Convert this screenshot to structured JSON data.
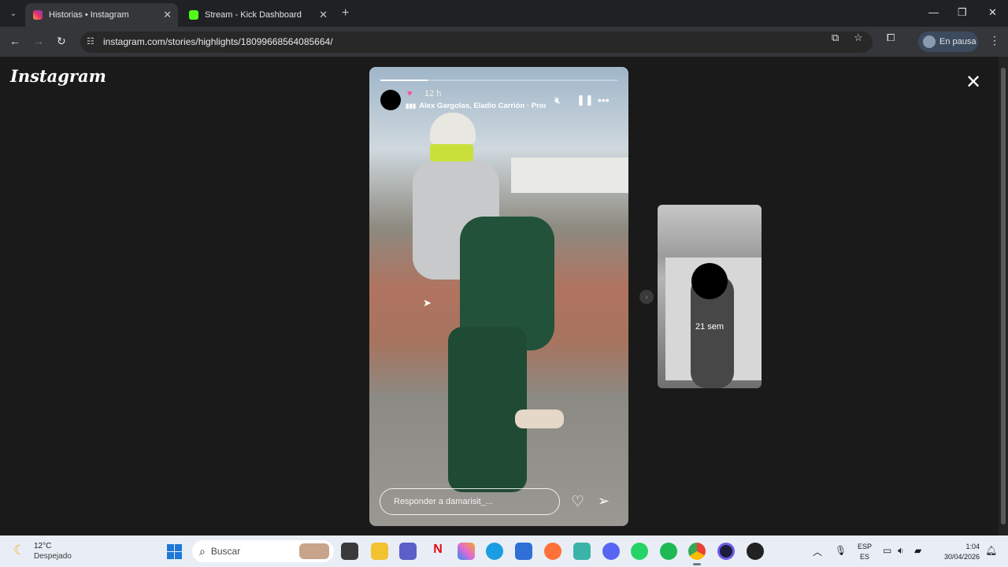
{
  "browser": {
    "tabs": [
      {
        "title": "Historias • Instagram",
        "active": true
      },
      {
        "title": "Stream - Kick Dashboard",
        "active": false
      }
    ],
    "url": "instagram.com/stories/highlights/18099668564085664/",
    "profile_label": "En pausa"
  },
  "page": {
    "logo": "Instagram",
    "story": {
      "time": "12 h",
      "music": "Alex Gargolas, Eladio Carrión · Prom",
      "reply_placeholder": "Responder a damarisit_...",
      "progress": 0.2
    },
    "next_story": {
      "age": "21 sem"
    }
  },
  "taskbar": {
    "weather_temp": "12°C",
    "weather_desc": "Despejado",
    "search_placeholder": "Buscar",
    "lang_top": "ESP",
    "lang_bottom": "ES",
    "time": "1:04",
    "date": "30/04/2026"
  },
  "colors": {
    "tab_active": "#35363a",
    "instagram_pink": "#ff4fa0",
    "windows_blue": "#1e78d6"
  }
}
